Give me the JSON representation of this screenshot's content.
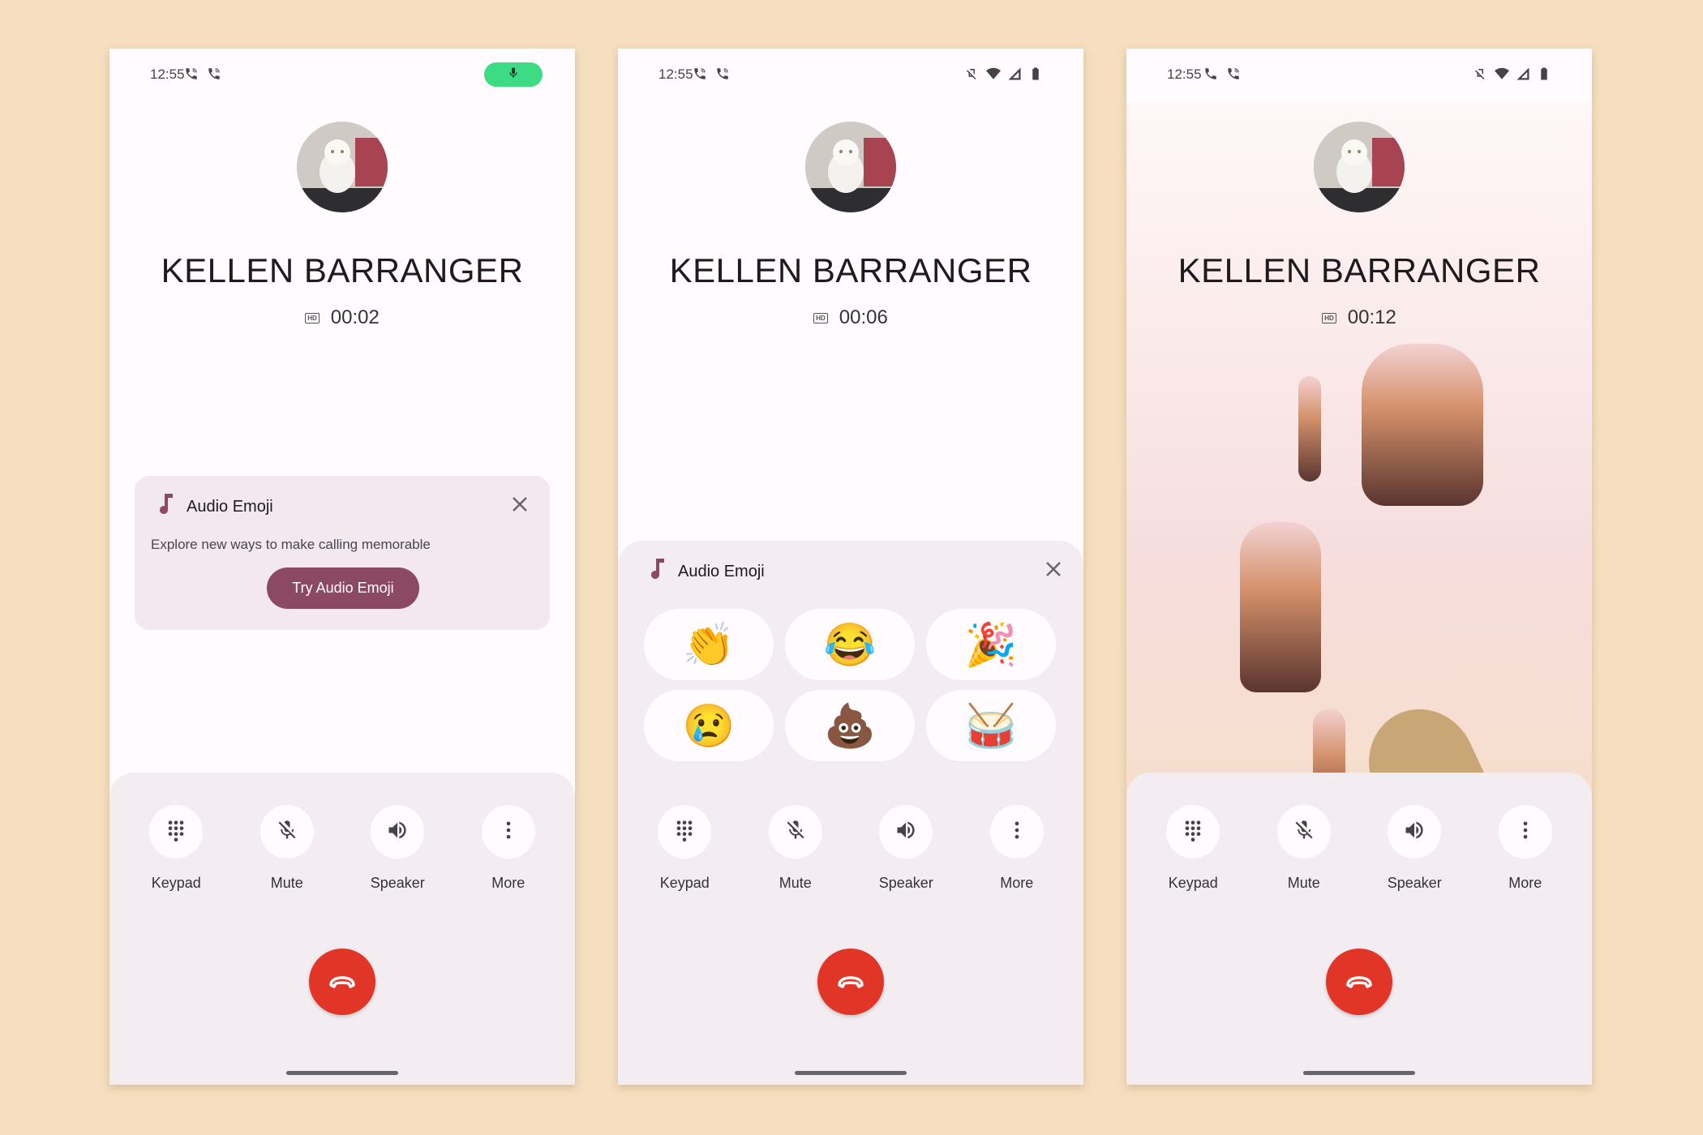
{
  "status_bar": {
    "time": "12:55",
    "left_icons": [
      "call-icon",
      "wifi-call-icon"
    ],
    "right_icons": [
      "vibrate-off-icon",
      "wifi-icon",
      "signal-icon",
      "battery-icon"
    ],
    "mic_indicator_color": "#3ddc84"
  },
  "contact": {
    "name": "KELLEN BARRANGER",
    "avatar": "white-persian-cat-photo"
  },
  "panels": [
    {
      "timer": "00:02",
      "state": "audio-emoji-promo"
    },
    {
      "timer": "00:06",
      "state": "audio-emoji-picker"
    },
    {
      "timer": "00:12",
      "state": "audio-emoji-playing"
    }
  ],
  "hd_badge": "HD",
  "promo_card": {
    "title": "Audio Emoji",
    "description": "Explore new ways to make calling memorable",
    "button_label": "Try Audio Emoji"
  },
  "emoji_picker": {
    "title": "Audio Emoji",
    "emojis": [
      "👏",
      "😂",
      "🎉",
      "😢",
      "💩",
      "🥁"
    ],
    "emoji_names": [
      "clapping-hands",
      "tears-of-joy",
      "party-popper",
      "crying-face",
      "pile-of-poo",
      "drum"
    ]
  },
  "controls": [
    {
      "label": "Keypad",
      "icon": "dialpad-icon"
    },
    {
      "label": "Mute",
      "icon": "mic-off-icon"
    },
    {
      "label": "Speaker",
      "icon": "speaker-icon"
    },
    {
      "label": "More",
      "icon": "more-vert-icon"
    }
  ],
  "colors": {
    "accent": "#8c4a62",
    "end_call": "#e03527",
    "background": "#f5dfbf",
    "sheet": "#f3edf1"
  }
}
